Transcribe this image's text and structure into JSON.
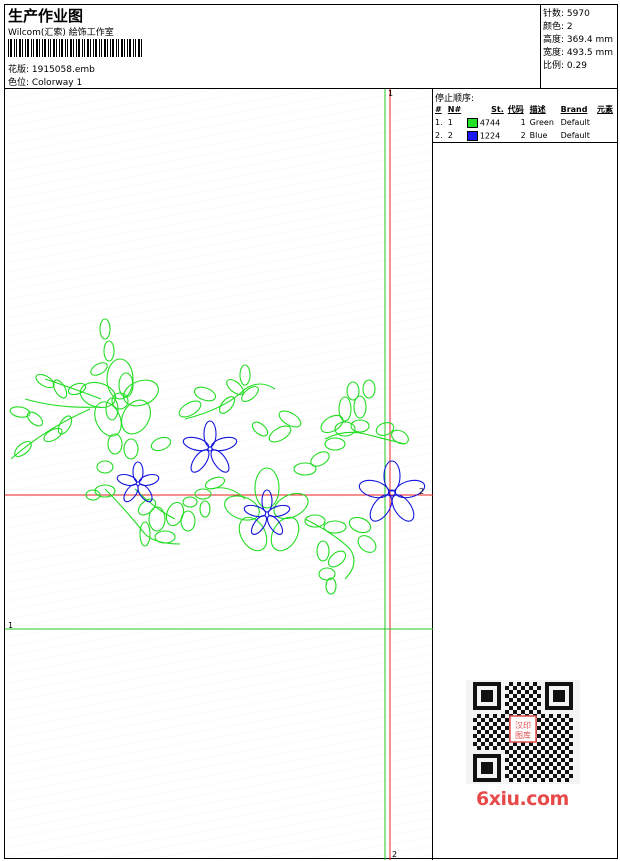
{
  "header": {
    "title": "生产作业图",
    "subtitle": "Wilcom(汇索) 絵饰工作室",
    "design_label": "花版: 1915058.emb",
    "colorway_label": "色位: Colorway 1"
  },
  "stats": [
    {
      "label": "针数: 5970"
    },
    {
      "label": "颜色: 2"
    },
    {
      "label": "高度: 369.4 mm"
    },
    {
      "label": "宽度: 493.5 mm"
    },
    {
      "label": "比例: 0.29"
    }
  ],
  "stop_sequence": {
    "title": "停止顺序:",
    "columns": [
      "#",
      "N#",
      "St.",
      "代码",
      "描述",
      "Brand",
      "元素"
    ],
    "rows": [
      {
        "idx": "1.",
        "n": "1",
        "stitches": "4744",
        "code": "1",
        "desc": "Green",
        "brand": "Default",
        "color": "#22e022"
      },
      {
        "idx": "2.",
        "n": "2",
        "stitches": "1224",
        "code": "2",
        "desc": "Blue",
        "brand": "Default",
        "color": "#1a1aee"
      }
    ]
  },
  "guides": {
    "v1_label": "1",
    "v2_label": "2",
    "h1_label": "1",
    "h2_label": "2"
  },
  "colors": {
    "green_thread": "#22dd22",
    "blue_thread": "#1515dd",
    "red_guide": "#ee2222",
    "green_guide": "#22cc22"
  },
  "watermark": {
    "text": "6xiu.com",
    "seal": "汉印图库"
  }
}
